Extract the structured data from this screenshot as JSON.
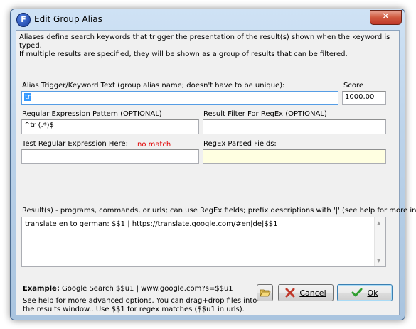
{
  "window": {
    "title": "Edit Group Alias",
    "app_icon_letter": "F",
    "close_glyph": "✕"
  },
  "description": {
    "line1": "Aliases define search keywords that trigger the presentation of the result(s) shown when the keyword is typed.",
    "line2": "If multiple results are specified, they will be shown as a group of results that can be filtered."
  },
  "alias": {
    "label": "Alias Trigger/Keyword Text (group alias name; doesn't have to be unique):",
    "value": "tr"
  },
  "score": {
    "label": "Score",
    "value": "1000.00"
  },
  "regex_pattern": {
    "label": "Regular Expression Pattern (OPTIONAL)",
    "value": "^tr (.*)$"
  },
  "result_filter": {
    "label": "Result Filter For RegEx (OPTIONAL)",
    "value": ""
  },
  "test_regex": {
    "label": "Test Regular Expression Here:",
    "status": "no match",
    "value": ""
  },
  "parsed_fields": {
    "label": "RegEx Parsed Fields:",
    "value": ""
  },
  "results": {
    "label": "Result(s) - programs, commands, or urls; can use RegEx fields; prefix descriptions with '|' (see help for more info)",
    "value": "translate en to german: $$1 | https://translate.google.com/#en|de|$$1"
  },
  "footer": {
    "example_label": "Example:",
    "example_text": " Google Search $$u1 | www.google.com?s=$$u1",
    "help_text": "See help for more advanced options.  You can drag+drop files into the results window.. Use $$1 for regex matches ($$u1 in urls)."
  },
  "buttons": {
    "cancel_label": "Cancel",
    "ok_label": "Ok"
  },
  "colors": {
    "error": "#e00000",
    "selection": "#3399ff",
    "readonly_field": "#ffffe1",
    "ok_check": "#2e9e2e",
    "cancel_x": "#c0392b"
  },
  "icons": [
    "app-icon",
    "close-icon",
    "scroll-up-icon",
    "scroll-down-icon",
    "open-folder-icon",
    "cancel-x-icon",
    "ok-check-icon"
  ]
}
